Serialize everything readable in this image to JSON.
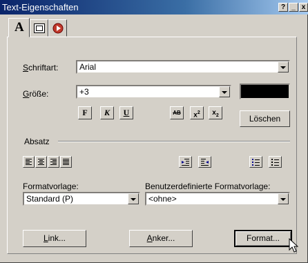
{
  "window": {
    "title": "Text-Eigenschaften",
    "help_glyph": "?",
    "minimize_glyph": "_",
    "close_glyph": "x"
  },
  "tabs": [
    {
      "label": "A",
      "icon": "text-icon",
      "selected": true
    },
    {
      "label": "",
      "icon": "image-frame-icon",
      "selected": false
    },
    {
      "label": "",
      "icon": "record-icon",
      "selected": false
    }
  ],
  "font": {
    "label_prefix": "S",
    "label_rest": "chriftart:",
    "value": "Arial"
  },
  "size": {
    "label_prefix": "G",
    "label_rest": "röße:",
    "value": "+3"
  },
  "color_swatch": "#000000",
  "style_buttons": {
    "bold": "F",
    "italic": "K",
    "underline": "U"
  },
  "effect_buttons": {
    "strikethrough": "AB",
    "superscript": "x2",
    "subscript": "x2"
  },
  "clear_button": "Löschen",
  "paragraph": {
    "heading": "Absatz"
  },
  "align_buttons": [
    "align-left",
    "align-center",
    "align-right",
    "align-justify"
  ],
  "indent_buttons": [
    "outdent",
    "indent"
  ],
  "list_buttons": [
    "numbered-list",
    "bulleted-list"
  ],
  "format_template": {
    "label": "Formatvorlage:",
    "value": "Standard (P)"
  },
  "custom_template": {
    "label": "Benutzerdefinierte Formatvorlage:",
    "value": "<ohne>"
  },
  "buttons": {
    "link_prefix": "L",
    "link_rest": "ink...",
    "anchor_prefix": "A",
    "anchor_rest": "nker...",
    "format": "Format..."
  }
}
